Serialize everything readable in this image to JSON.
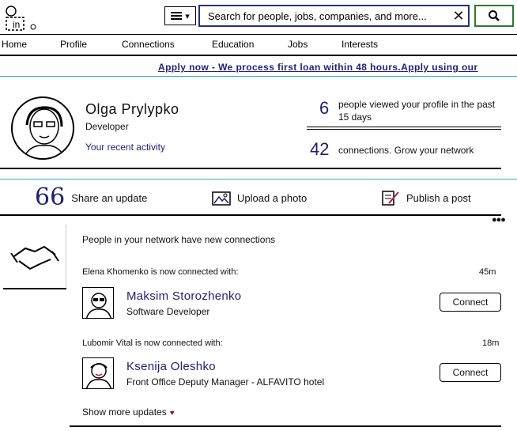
{
  "search": {
    "placeholder": "Search for people, jobs, companies, and more..."
  },
  "nav": [
    "Home",
    "Profile",
    "Connections",
    "Education",
    "Jobs",
    "Interests"
  ],
  "banner": "Apply now - We process first loan within 48 hours.Apply using our",
  "profile": {
    "name": "Olga Prylypko",
    "title": "Developer",
    "activity": "Your recent activity"
  },
  "stats": {
    "views_count": "6",
    "views_text": "people viewed your profile in the past 15 days",
    "connections_count": "42",
    "connections_text": "connections. Grow your network"
  },
  "share": {
    "update": "Share an update",
    "photo": "Upload a photo",
    "post": "Publish a post"
  },
  "feed": {
    "title": "People in your network have new connections",
    "items": [
      {
        "header": "Elena Khomenko is now connected with:",
        "time": "45m",
        "name": "Maksim Storozhenko",
        "role": "Software Developer",
        "button": "Connect"
      },
      {
        "header": "Lubomir Vital is now connected with:",
        "time": "18m",
        "name": "Ksenija Oleshko",
        "role": "Front Office Deputy Manager - ALFAVITO hotel",
        "button": "Connect"
      }
    ],
    "more": "Show more updates"
  },
  "colors": {
    "link": "#1f1f73",
    "divider_accent": "#3aaacc",
    "search_btn": "#2d7a2d"
  }
}
